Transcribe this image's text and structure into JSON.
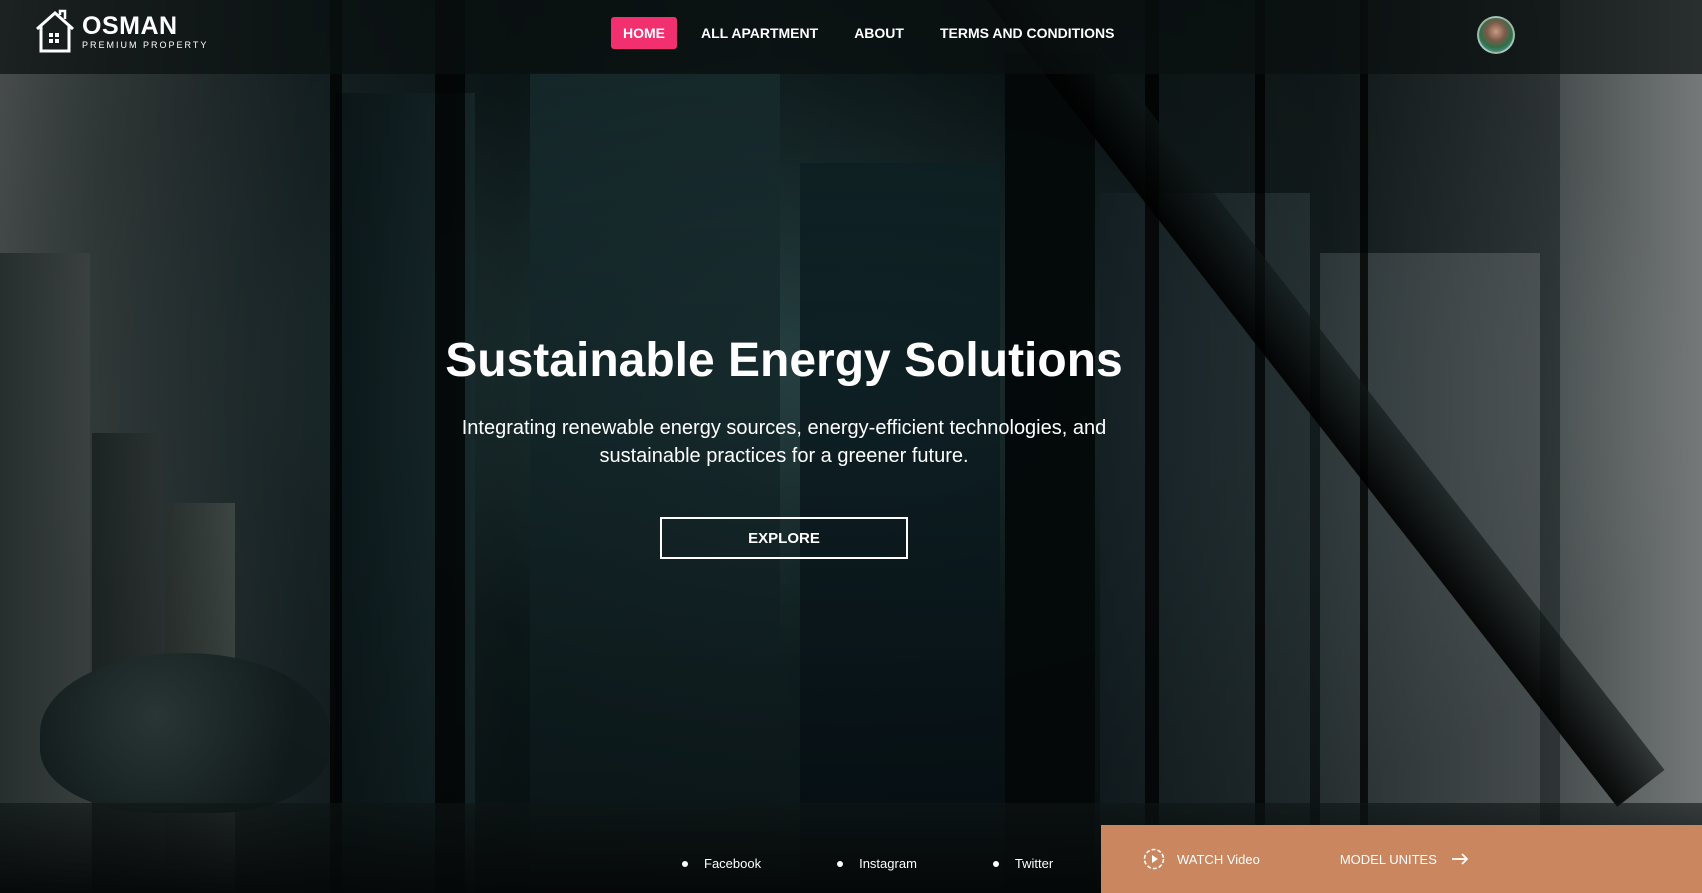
{
  "header": {
    "logo_name": "OSMAN",
    "logo_sub": "PREMIUM PROPERTY",
    "nav": [
      {
        "label": "HOME",
        "active": true
      },
      {
        "label": "ALL APARTMENT",
        "active": false
      },
      {
        "label": "ABOUT",
        "active": false
      },
      {
        "label": "TERMS AND CONDITIONS",
        "active": false
      }
    ]
  },
  "hero": {
    "title": "Sustainable Energy Solutions",
    "subtitle": "Integrating renewable energy sources, energy-efficient technologies, and sustainable practices for a greener future.",
    "cta_label": "EXPLORE"
  },
  "footer": {
    "socials": [
      "Facebook",
      "Instagram",
      "Twitter"
    ],
    "watch_label": "WATCH Video",
    "model_label": "MODEL UNITES"
  },
  "colors": {
    "accent": "#f3306f",
    "cta_bar": "#c9865f"
  },
  "icons": {
    "logo": "house-icon",
    "watch": "play-circle-icon",
    "model": "arrow-right-icon"
  }
}
